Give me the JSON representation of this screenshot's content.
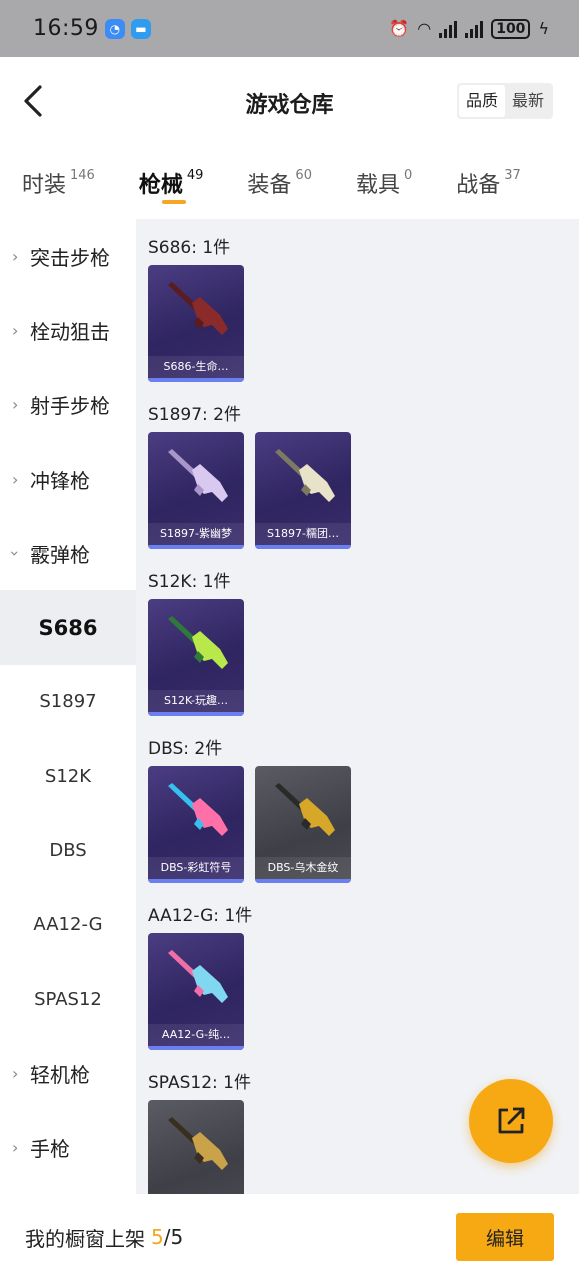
{
  "status": {
    "time": "16:59",
    "battery": "100"
  },
  "header": {
    "title": "游戏仓库",
    "sort_quality": "品质",
    "sort_newest": "最新"
  },
  "tabs": [
    {
      "label": "时装",
      "count": "146"
    },
    {
      "label": "枪械",
      "count": "49"
    },
    {
      "label": "装备",
      "count": "60"
    },
    {
      "label": "载具",
      "count": "0"
    },
    {
      "label": "战备",
      "count": "37"
    }
  ],
  "sidebar": {
    "items": [
      {
        "label": "突击步枪"
      },
      {
        "label": "栓动狙击"
      },
      {
        "label": "射手步枪"
      },
      {
        "label": "冲锋枪"
      },
      {
        "label": "霰弹枪"
      },
      {
        "label": "S686"
      },
      {
        "label": "S1897"
      },
      {
        "label": "S12K"
      },
      {
        "label": "DBS"
      },
      {
        "label": "AA12-G"
      },
      {
        "label": "SPAS12"
      },
      {
        "label": "轻机枪"
      },
      {
        "label": "手枪"
      }
    ]
  },
  "groups": [
    {
      "title": "S686: 1件",
      "items": [
        {
          "name": "S686-生命…",
          "style": "purple",
          "icon": "shotgun-red-icon"
        }
      ]
    },
    {
      "title": "S1897: 2件",
      "items": [
        {
          "name": "S1897-紫幽梦",
          "style": "purple",
          "icon": "shotgun-violet-icon"
        },
        {
          "name": "S1897-糯团…",
          "style": "purple",
          "icon": "shotgun-cream-icon"
        }
      ]
    },
    {
      "title": "S12K: 1件",
      "items": [
        {
          "name": "S12K-玩趣…",
          "style": "purple",
          "icon": "shotgun-lime-icon"
        }
      ]
    },
    {
      "title": "DBS: 2件",
      "items": [
        {
          "name": "DBS-彩虹符号",
          "style": "purple",
          "icon": "shotgun-rainbow-icon"
        },
        {
          "name": "DBS-乌木金纹",
          "style": "grey",
          "icon": "shotgun-gold-icon"
        }
      ]
    },
    {
      "title": "AA12-G: 1件",
      "items": [
        {
          "name": "AA12-G-纯…",
          "style": "purple",
          "icon": "shotgun-pastel-icon"
        }
      ]
    },
    {
      "title": "SPAS12: 1件",
      "items": [
        {
          "name": "",
          "style": "grey",
          "icon": "shotgun-brown-icon"
        }
      ]
    }
  ],
  "bottom": {
    "label": "我的橱窗上架",
    "count": "5",
    "separator": "/",
    "total": "5",
    "edit_label": "编辑"
  },
  "colors": {
    "accent": "#f6a913",
    "card_purple": "#3a2d6c",
    "card_grey": "#4a4b52",
    "card_bar": "#6b7ff0"
  }
}
